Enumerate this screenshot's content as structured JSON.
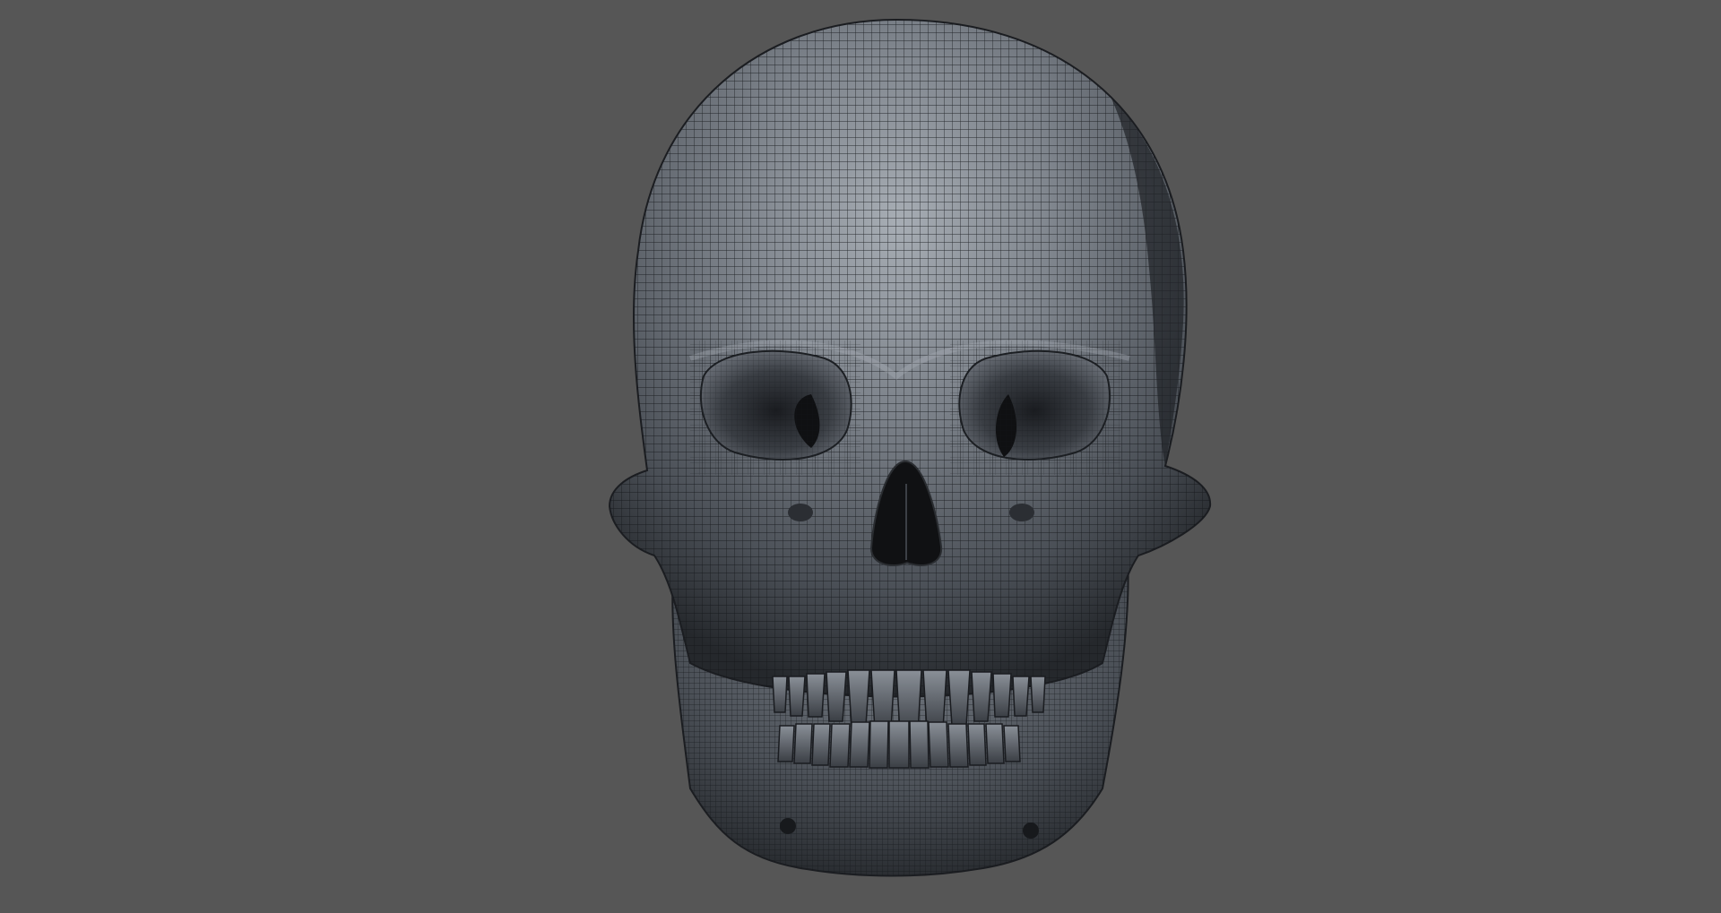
{
  "viewport": {
    "background_color": "#565656",
    "subject": "skull-wireframe-model",
    "colors": {
      "surface_light": "#9ba1a8",
      "surface_mid": "#6a7078",
      "surface_dark": "#2d3035",
      "wire": "#16181c",
      "cavity": "#0f1012"
    }
  }
}
